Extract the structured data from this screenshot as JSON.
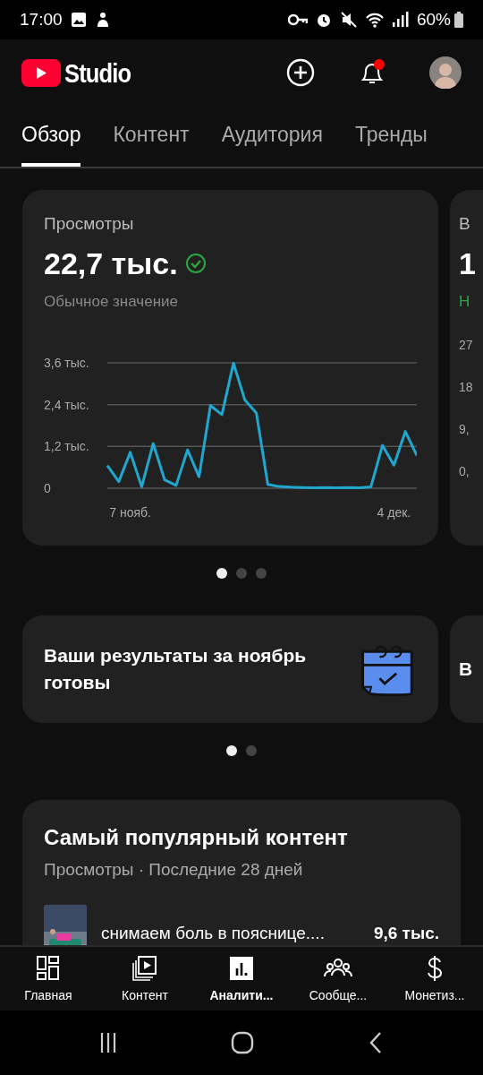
{
  "status_bar": {
    "time": "17:00",
    "battery": "60%"
  },
  "header": {
    "logo_text": "Studio",
    "notifications": {
      "unread": true
    }
  },
  "tabs": [
    {
      "label": "Обзор",
      "selected": true
    },
    {
      "label": "Контент",
      "selected": false
    },
    {
      "label": "Аудитория",
      "selected": false
    },
    {
      "label": "Тренды",
      "selected": false
    }
  ],
  "metric_cards": [
    {
      "title": "Просмотры",
      "value": "22,7 тыс.",
      "note": "Обычное значение",
      "chart_data": {
        "type": "line",
        "categories": [
          null,
          null,
          "7 нояб.",
          null,
          null,
          null,
          null,
          null,
          null,
          null,
          null,
          null,
          null,
          null,
          null,
          null,
          null,
          null,
          null,
          null,
          null,
          null,
          null,
          null,
          null,
          "4 дек.",
          null,
          null
        ],
        "yticks": [
          {
            "value": 0,
            "label": "0"
          },
          {
            "value": 1.2,
            "label": "1,2 тыс."
          },
          {
            "value": 2.4,
            "label": "2,4 тыс."
          },
          {
            "value": 3.6,
            "label": "3,6 тыс."
          }
        ],
        "ylim": [
          0,
          3.6
        ],
        "series": [
          {
            "color": "#1fa7d0",
            "values": [
              0.65,
              0.19,
              1.03,
              0.04,
              1.28,
              0.24,
              0.08,
              1.1,
              0.33,
              2.37,
              2.11,
              3.59,
              2.53,
              2.16,
              0.11,
              0.05,
              0.03,
              0.02,
              0.01,
              0.02,
              0.01,
              0.02,
              0.01,
              0.04,
              1.23,
              0.66,
              1.63,
              0.94
            ]
          }
        ]
      }
    }
  ],
  "metric_peek": {
    "title": "В",
    "value": "1",
    "note": "Н",
    "axis_labels": [
      "27",
      "18",
      "9,",
      "0,"
    ]
  },
  "metric_pager": [
    {
      "selected": true
    },
    {
      "selected": false
    },
    {
      "selected": false
    }
  ],
  "promo_cards": [
    {
      "text": "Ваши результаты за ноябрь готовы"
    }
  ],
  "promo_peek": {
    "text": "В"
  },
  "promo_pager": [
    {
      "selected": true
    },
    {
      "selected": false
    }
  ],
  "top_content": {
    "title": "Самый популярный контент",
    "subtitle": "Просмотры · Последние 28 дней",
    "items": [
      {
        "title": "снимаем боль в пояснице....",
        "views": "9,6 тыс."
      }
    ]
  },
  "bottom_nav": [
    {
      "label": "Главная",
      "kind": "home",
      "selected": false
    },
    {
      "label": "Контент",
      "kind": "content",
      "selected": false
    },
    {
      "label": "Аналити...",
      "kind": "analytics",
      "selected": true
    },
    {
      "label": "Сообще...",
      "kind": "community",
      "selected": false
    },
    {
      "label": "Монетиз...",
      "kind": "money",
      "selected": false
    }
  ]
}
